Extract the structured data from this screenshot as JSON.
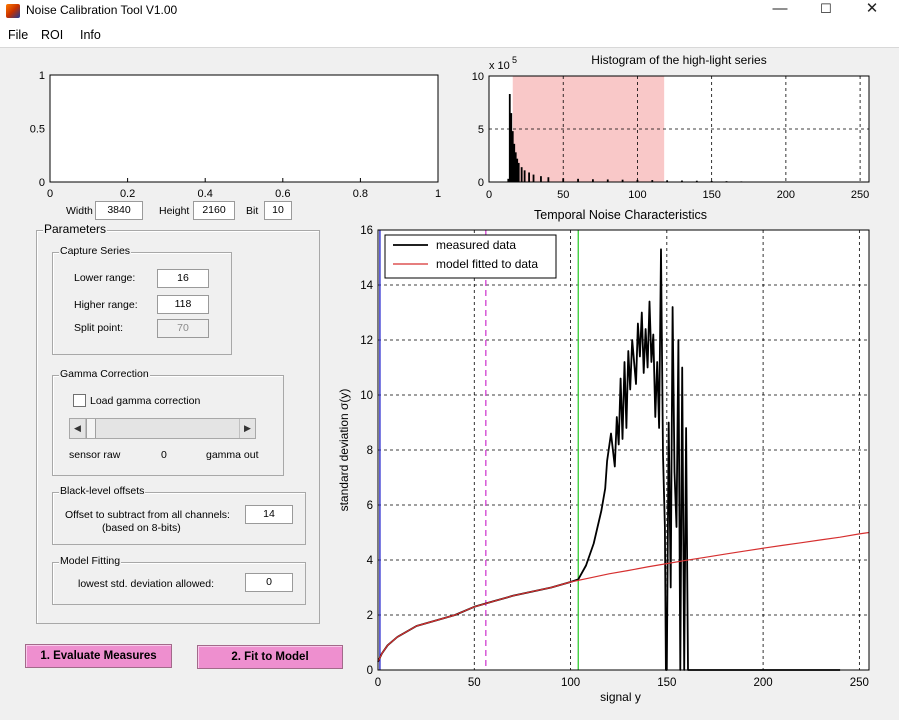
{
  "window": {
    "title": "Noise Calibration Tool V1.00"
  },
  "menu": [
    "File",
    "ROI",
    "Info"
  ],
  "image_axes": {
    "yticks": [
      "1",
      "0.5",
      "0"
    ],
    "xticks": [
      "0",
      "0.2",
      "0.4",
      "0.6",
      "0.8",
      "1"
    ]
  },
  "image_size": {
    "width_label": "Width",
    "width_value": "3840",
    "height_label": "Height",
    "height_value": "2160",
    "bit_label": "Bit",
    "bit_value": "10"
  },
  "parameters": {
    "title": "Parameters",
    "capture_series": {
      "title": "Capture Series",
      "lower_label": "Lower range:",
      "lower_value": "16",
      "higher_label": "Higher range:",
      "higher_value": "118",
      "split_label": "Split point:",
      "split_value": "70"
    },
    "gamma": {
      "title": "Gamma Correction",
      "checkbox_label": "Load gamma correction",
      "left_label": "sensor raw",
      "value": "0",
      "right_label": "gamma out",
      "slider_level": 0
    },
    "black_level": {
      "title": "Black-level offsets",
      "label_line1": "Offset to subtract from all channels:",
      "label_line2": "(based on 8-bits)",
      "value": "14"
    },
    "model_fitting": {
      "title": "Model Fitting",
      "label": "lowest std. deviation allowed:",
      "value": "0"
    }
  },
  "buttons": {
    "evaluate": "1. Evaluate Measures",
    "fit": "2. Fit to Model"
  },
  "colors": {
    "button_pink": "#ee8fcf",
    "histogram_range": "#f9c8c8",
    "model_line": "#d63030",
    "measured_line": "#000000",
    "split_line": "#d040d0",
    "marker_line": "#33cc33",
    "left_line": "#2020cc"
  },
  "chart_data": [
    {
      "type": "bar",
      "title": "Histogram of the high-light series",
      "y_exponent": "x 10",
      "y_exponent_power": "5",
      "xlim": [
        0,
        256
      ],
      "ylim": [
        0,
        10
      ],
      "xticks": [
        "0",
        "50",
        "100",
        "150",
        "200",
        "250"
      ],
      "yticks": [
        "0",
        "5",
        "10"
      ],
      "highlight_range": [
        16,
        118
      ],
      "grid": true,
      "x": [
        13,
        14,
        15,
        16,
        17,
        18,
        19,
        20,
        22,
        24,
        27,
        30,
        35,
        40,
        50,
        60,
        70,
        80,
        90,
        100,
        110,
        120,
        130,
        140,
        150,
        160,
        170,
        175,
        180
      ],
      "values": [
        0.3,
        8.3,
        6.5,
        4.8,
        3.6,
        2.8,
        2.2,
        1.8,
        1.4,
        1.1,
        0.9,
        0.7,
        0.55,
        0.45,
        0.35,
        0.3,
        0.26,
        0.24,
        0.22,
        0.2,
        0.18,
        0.16,
        0.14,
        0.12,
        0.1,
        0.08,
        0.06,
        0.04,
        0.02
      ]
    },
    {
      "type": "line",
      "title": "Temporal Noise Characteristics",
      "xlabel": "signal y",
      "ylabel": "standard deviation σ(y)",
      "xlim": [
        0,
        255
      ],
      "ylim": [
        0,
        16
      ],
      "xticks": [
        "0",
        "50",
        "100",
        "150",
        "200",
        "250"
      ],
      "yticks": [
        "0",
        "2",
        "4",
        "6",
        "8",
        "10",
        "12",
        "14",
        "16"
      ],
      "grid": true,
      "legend": "top-left",
      "vertical_lines": {
        "split": 56,
        "marker": 104,
        "left": 1
      },
      "series": [
        {
          "name": "measured data",
          "x": [
            0,
            2,
            5,
            10,
            20,
            30,
            40,
            50,
            60,
            70,
            80,
            90,
            95,
            100,
            104,
            108,
            112,
            116,
            118,
            119,
            121,
            123,
            124,
            125,
            126,
            127,
            128,
            129,
            130,
            131,
            132,
            133,
            134,
            135,
            136,
            137,
            138,
            139,
            140,
            141,
            142,
            143,
            144,
            145,
            146,
            147,
            148,
            149,
            149.5,
            150,
            151,
            152,
            153,
            154,
            155,
            156,
            157,
            158,
            159,
            160,
            161,
            170,
            200,
            240
          ],
          "y": [
            0.3,
            0.6,
            0.9,
            1.2,
            1.6,
            1.8,
            2.0,
            2.3,
            2.5,
            2.7,
            2.85,
            3.0,
            3.1,
            3.2,
            3.3,
            3.8,
            4.6,
            5.8,
            6.6,
            7.6,
            8.6,
            7.4,
            9.2,
            8.2,
            10.6,
            8.4,
            11.2,
            8.8,
            11.6,
            10.2,
            12.0,
            11.2,
            10.4,
            12.6,
            11.4,
            13.0,
            10.8,
            12.4,
            11.0,
            13.4,
            11.2,
            12.2,
            9.2,
            11.2,
            8.8,
            15.3,
            7.8,
            5.2,
            0,
            0,
            9.0,
            3.0,
            13.2,
            7.2,
            5.2,
            12.0,
            0,
            11.0,
            0,
            8.8,
            0,
            0,
            0,
            0
          ]
        },
        {
          "name": "model fitted to data",
          "x": [
            0,
            2,
            5,
            10,
            20,
            30,
            40,
            50,
            60,
            70,
            80,
            90,
            100,
            110,
            120,
            130,
            140,
            150,
            160,
            170,
            180,
            190,
            200,
            210,
            220,
            230,
            240,
            250,
            255
          ],
          "y": [
            0.3,
            0.6,
            0.9,
            1.2,
            1.6,
            1.8,
            2.0,
            2.3,
            2.5,
            2.7,
            2.85,
            3.0,
            3.2,
            3.35,
            3.5,
            3.62,
            3.75,
            3.87,
            3.99,
            4.1,
            4.21,
            4.32,
            4.43,
            4.53,
            4.63,
            4.73,
            4.83,
            4.95,
            5.0
          ]
        }
      ]
    }
  ]
}
